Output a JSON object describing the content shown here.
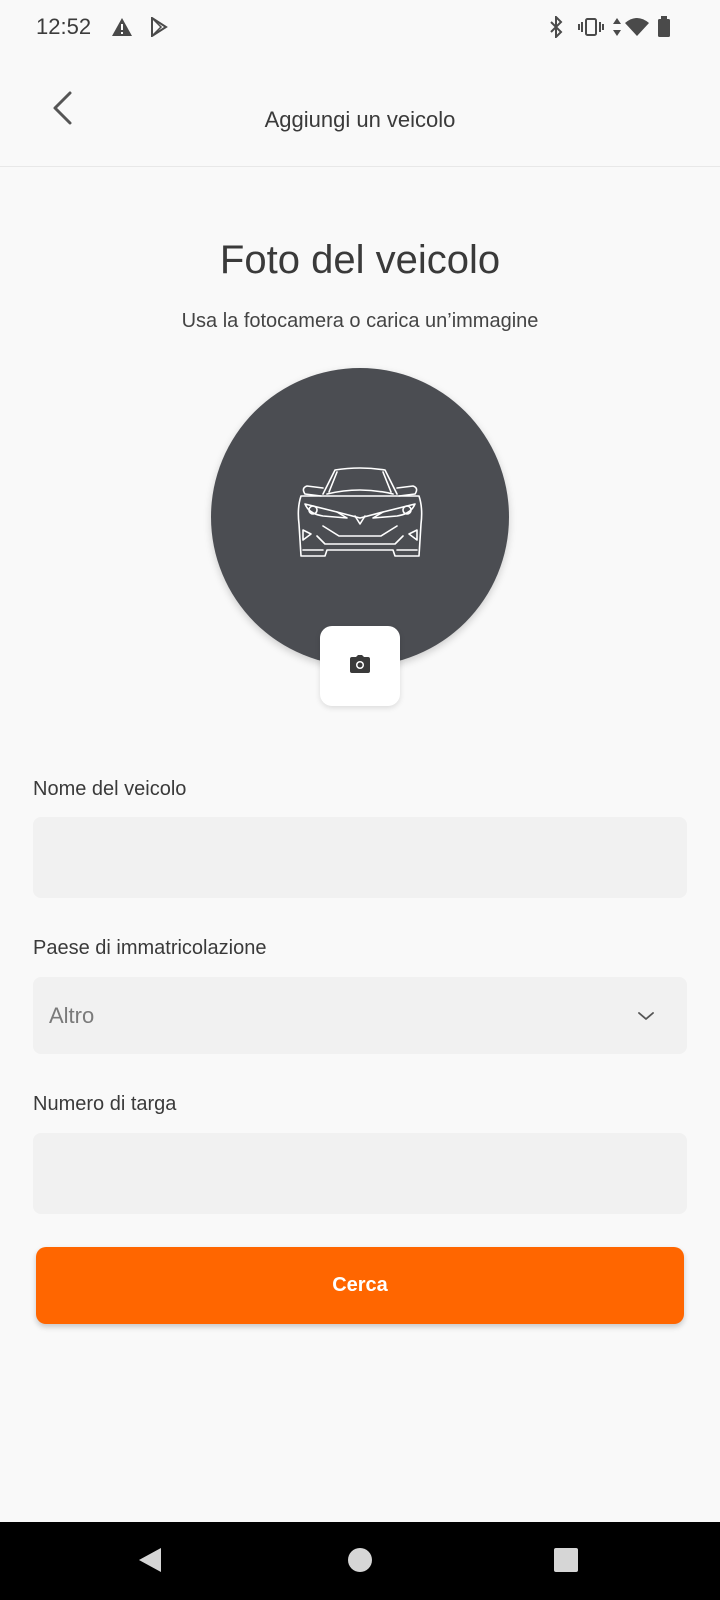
{
  "status_bar": {
    "time": "12:52",
    "left_icons": [
      "alert-triangle-icon",
      "play-store-icon"
    ],
    "right_icons": [
      "bluetooth-icon",
      "vibrate-icon",
      "data-arrows-icon",
      "wifi-icon",
      "battery-icon"
    ]
  },
  "app_bar": {
    "title": "Aggiungi un veicolo",
    "back_icon": "chevron-left-icon"
  },
  "photo_section": {
    "title": "Foto del veicolo",
    "subtitle": "Usa la fotocamera o carica un’immagine",
    "placeholder_icon": "car-icon",
    "camera_icon": "camera-icon"
  },
  "form": {
    "vehicle_name": {
      "label": "Nome del veicolo",
      "value": ""
    },
    "registration_country": {
      "label": "Paese di immatricolazione",
      "selected": "Altro",
      "icon": "chevron-down-icon"
    },
    "plate_number": {
      "label": "Numero di targa",
      "value": ""
    },
    "search_button_label": "Cerca"
  },
  "colors": {
    "accent": "#ff6600",
    "circle": "#4b4d52",
    "background": "#f9f9f9",
    "field_background": "#f1f1f1"
  },
  "nav_bar": {
    "icons": [
      "nav-back-icon",
      "nav-home-icon",
      "nav-recents-icon"
    ]
  }
}
